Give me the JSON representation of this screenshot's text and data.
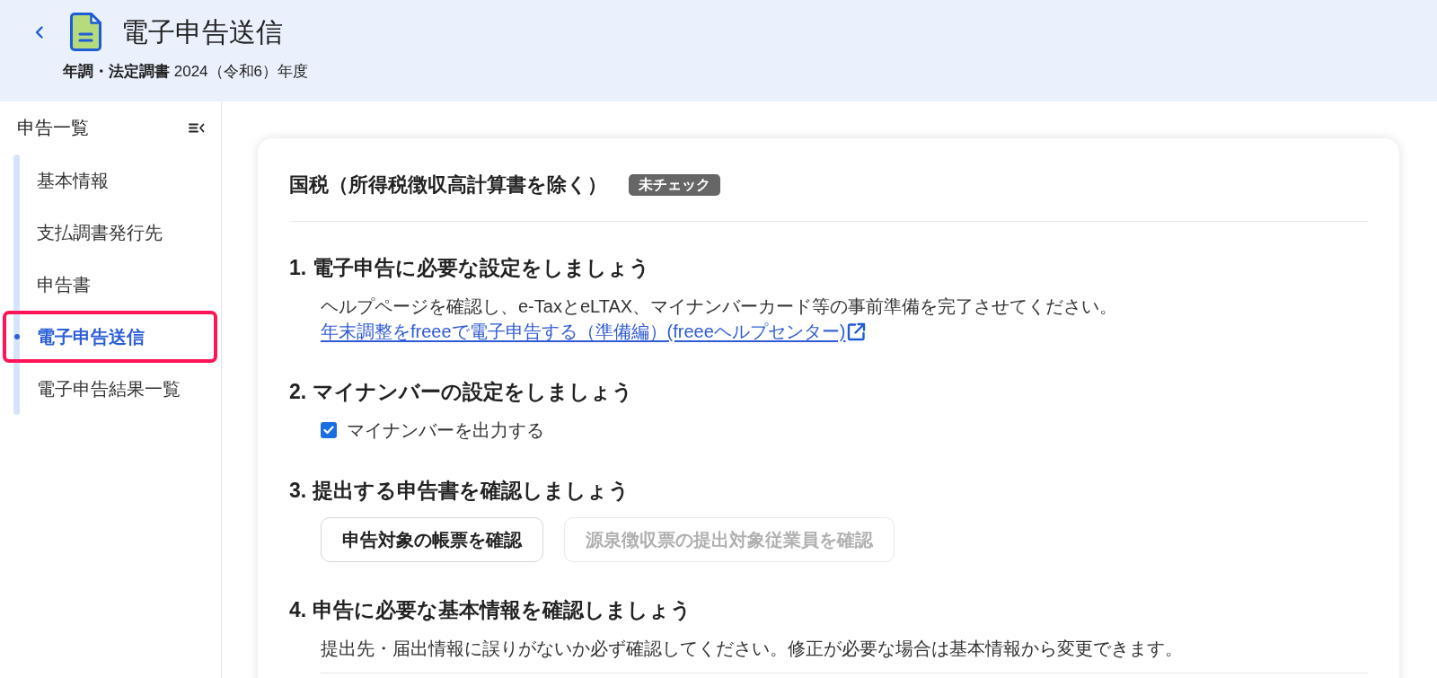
{
  "header": {
    "title": "電子申告送信",
    "subtitle": "**年調・法定調書** 2024（令和6）年度"
  },
  "sidebar": {
    "title": "申告一覧",
    "items": [
      {
        "label": "基本情報",
        "selected": false,
        "highlighted": false
      },
      {
        "label": "支払調書発行先",
        "selected": false,
        "highlighted": false
      },
      {
        "label": "申告書",
        "selected": false,
        "highlighted": false
      },
      {
        "label": "電子申告送信",
        "selected": true,
        "highlighted": true
      },
      {
        "label": "電子申告結果一覧",
        "selected": false,
        "highlighted": false
      }
    ]
  },
  "card": {
    "title": "国税（所得税徴収高計算書を除く）",
    "badge": "未チェック",
    "sections": [
      {
        "kind": "info",
        "heading": "1. 電子申告に必要な設定をしましょう",
        "text": "ヘルプページを確認し、e-TaxとeLTAX、マイナンバーカード等の事前準備を完了させてください。",
        "link": "年末調整をfreeeで電子申告する（準備編）(freeeヘルプセンター)"
      },
      {
        "kind": "checkbox",
        "heading": "2. マイナンバーの設定をしましょう",
        "checkbox": {
          "label": "マイナンバーを出力する",
          "checked": true
        }
      },
      {
        "kind": "buttons",
        "heading": "3. 提出する申告書を確認しましょう",
        "buttons": [
          {
            "label": "申告対象の帳票を確認",
            "disabled": false
          },
          {
            "label": "源泉徴収票の提出対象従業員を確認",
            "disabled": true
          }
        ]
      },
      {
        "kind": "info",
        "heading": "4. 申告に必要な基本情報を確認しましょう",
        "text": "提出先・届出情報に誤りがないか必ず確認してください。修正が必要な場合は基本情報から変更できます。"
      }
    ]
  }
}
